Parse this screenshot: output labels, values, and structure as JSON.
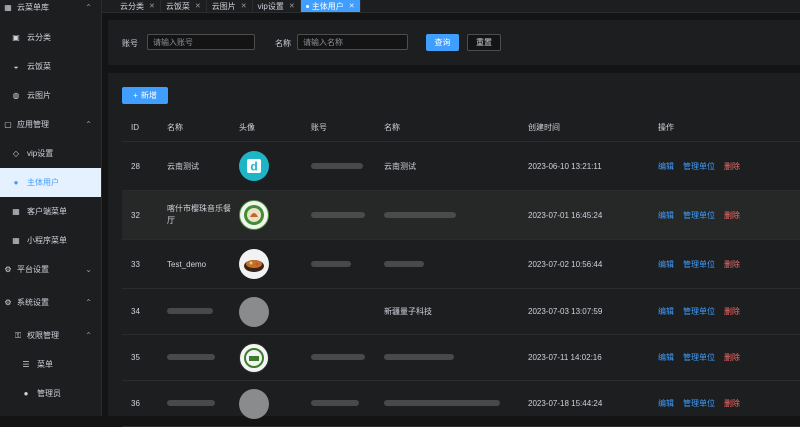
{
  "sidebar": {
    "groups": [
      {
        "label": "云菜单库",
        "icon": "grid-icon"
      },
      {
        "label": "应用管理",
        "icon": "app-icon"
      },
      {
        "label": "平台设置",
        "icon": "gear-icon"
      },
      {
        "label": "系统设置",
        "icon": "gear-icon"
      },
      {
        "label": "权限管理",
        "icon": "lock-icon"
      }
    ],
    "items": [
      {
        "label": "云分类"
      },
      {
        "label": "云饭菜"
      },
      {
        "label": "云图片"
      },
      {
        "label": "vip设置"
      },
      {
        "label": "主体用户"
      },
      {
        "label": "客户端菜单"
      },
      {
        "label": "小程序菜单"
      },
      {
        "label": "菜单"
      },
      {
        "label": "管理员"
      }
    ]
  },
  "tabs": [
    {
      "label": "云分类"
    },
    {
      "label": "云饭菜"
    },
    {
      "label": "云图片"
    },
    {
      "label": "vip设置"
    },
    {
      "label": "主体用户"
    }
  ],
  "search": {
    "account_label": "账号",
    "account_placeholder": "请输入账号",
    "name_label": "名称",
    "name_placeholder": "请输入名称",
    "query_button": "查询",
    "reset_button": "重置"
  },
  "add_button": "新增",
  "table": {
    "headers": [
      "ID",
      "名称",
      "头像",
      "账号",
      "名称",
      "创建时间",
      "操作"
    ],
    "rows": [
      {
        "id": "28",
        "name": "云南测试",
        "name2": "云南测试",
        "time": "2023-06-10 13:21:11"
      },
      {
        "id": "32",
        "name": "喀什市樱珠音乐餐厅",
        "name2": "",
        "time": "2023-07-01 16:45:24"
      },
      {
        "id": "33",
        "name": "Test_demo",
        "name2": "",
        "time": "2023-07-02 10:56:44"
      },
      {
        "id": "34",
        "name": "",
        "name2": "新疆量子科技",
        "time": "2023-07-03 13:07:59"
      },
      {
        "id": "35",
        "name": "",
        "name2": "",
        "time": "2023-07-11 14:02:16"
      },
      {
        "id": "36",
        "name": "",
        "name2": "",
        "time": "2023-07-18 15:44:24"
      }
    ],
    "actions": {
      "edit": "编辑",
      "manage": "管理单位",
      "delete": "删除"
    }
  }
}
